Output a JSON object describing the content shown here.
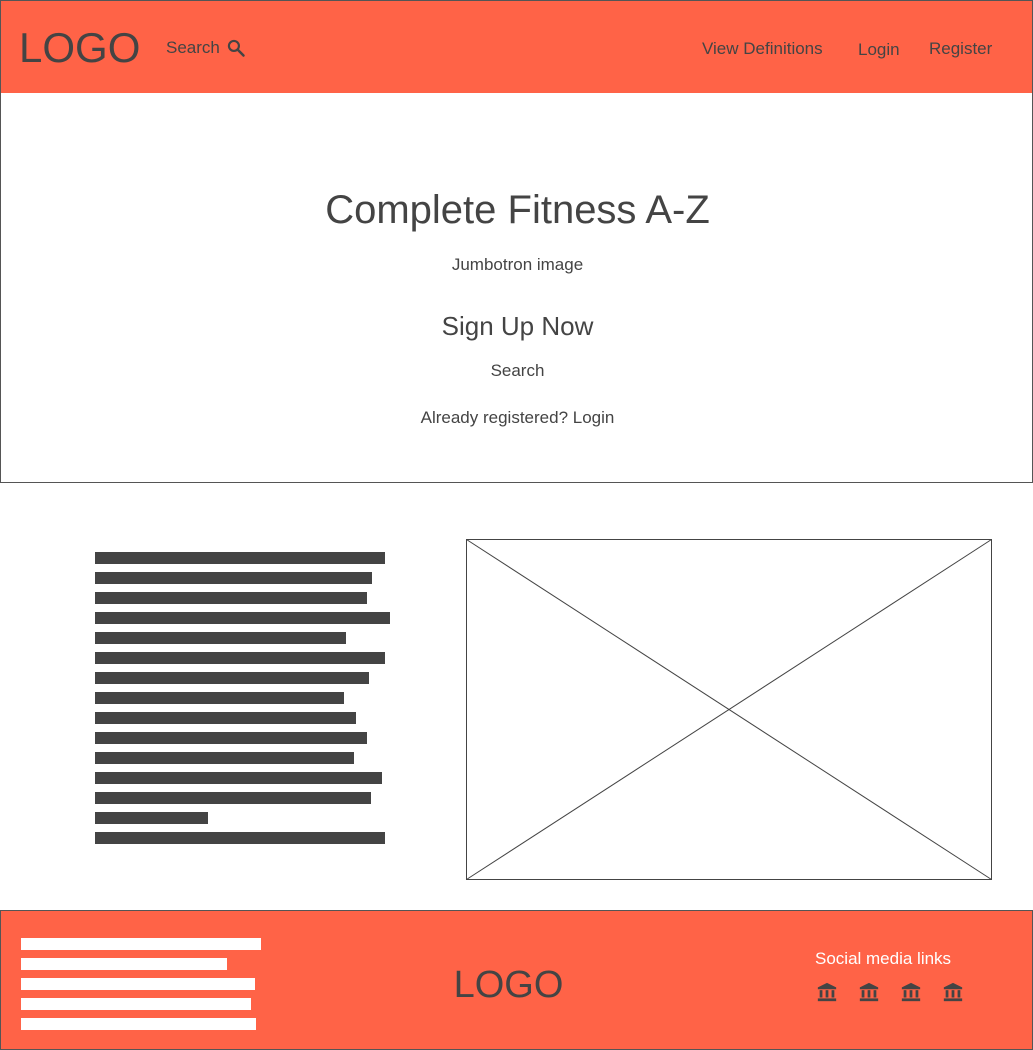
{
  "header": {
    "logo": "LOGO",
    "search_label": "Search",
    "search_icon": "search-icon",
    "nav": [
      "View Definitions",
      "Login",
      "Register"
    ],
    "background_color": "#ff6347"
  },
  "jumbotron": {
    "title": "Complete Fitness A-Z",
    "subtitle": "Jumbotron image",
    "cta": "Sign Up Now",
    "search": "Search",
    "login_prompt": "Already registered? Login"
  },
  "content": {
    "image_placeholder": "image-placeholder"
  },
  "footer": {
    "logo": "LOGO",
    "social_title": "Social media links",
    "social_icons": [
      "bank-icon",
      "bank-icon",
      "bank-icon",
      "bank-icon"
    ],
    "background_color": "#ff6347"
  }
}
